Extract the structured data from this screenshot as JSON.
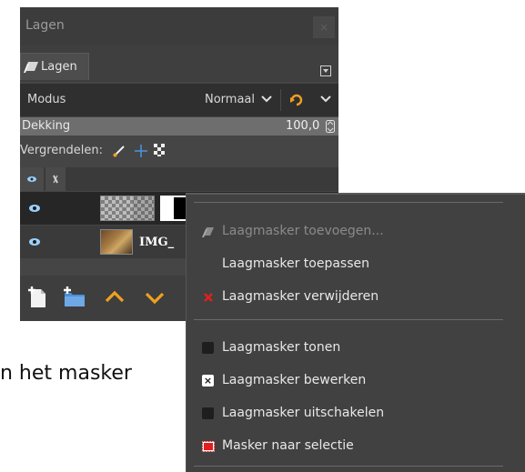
{
  "document": {
    "text_top": "",
    "text_bottom": "n het masker"
  },
  "panel": {
    "title": "Lagen",
    "close_glyph": "×",
    "tab_label": "Lagen",
    "mode_label": "Modus",
    "mode_value": "Normaal",
    "opacity_label": "Dekking",
    "opacity_value": "100,0",
    "lock_label": "Vergrendelen:",
    "layers": [
      {
        "name": "",
        "visible": true,
        "has_mask": true
      },
      {
        "name": "IMG_",
        "visible": true,
        "has_mask": false
      }
    ],
    "icons": {
      "tab": "layers-icon",
      "tab_menu": "tab-menu-icon",
      "blend": "composite-mode-icon",
      "lock_paint": "brush-icon",
      "lock_position": "move-icon",
      "lock_alpha": "checkerboard-icon",
      "bottom": [
        "new-layer-icon",
        "new-layer-group-icon",
        "raise-layer-icon",
        "lower-layer-icon"
      ]
    }
  },
  "context_menu": {
    "items": [
      {
        "label": "Laagmasker toevoegen...",
        "enabled": false,
        "icon": "add-mask-icon"
      },
      {
        "label": "Laagmasker toepassen",
        "enabled": true,
        "icon": ""
      },
      {
        "label": "Laagmasker verwijderen",
        "enabled": true,
        "icon": "delete-icon"
      },
      {
        "label": "Laagmasker tonen",
        "enabled": true,
        "icon": "checkbox-unchecked-icon",
        "checked": false
      },
      {
        "label": "Laagmasker bewerken",
        "enabled": true,
        "icon": "checkbox-checked-icon",
        "checked": true
      },
      {
        "label": "Laagmasker uitschakelen",
        "enabled": true,
        "icon": "checkbox-unchecked-icon",
        "checked": false
      },
      {
        "label": "Masker naar selectie",
        "enabled": true,
        "icon": "mask-to-selection-icon"
      }
    ]
  },
  "colors": {
    "accent_orange": "#f0a020",
    "accent_blue": "#4a90d9",
    "delete_red": "#e02020",
    "eye_blue": "#9ad0ff"
  }
}
